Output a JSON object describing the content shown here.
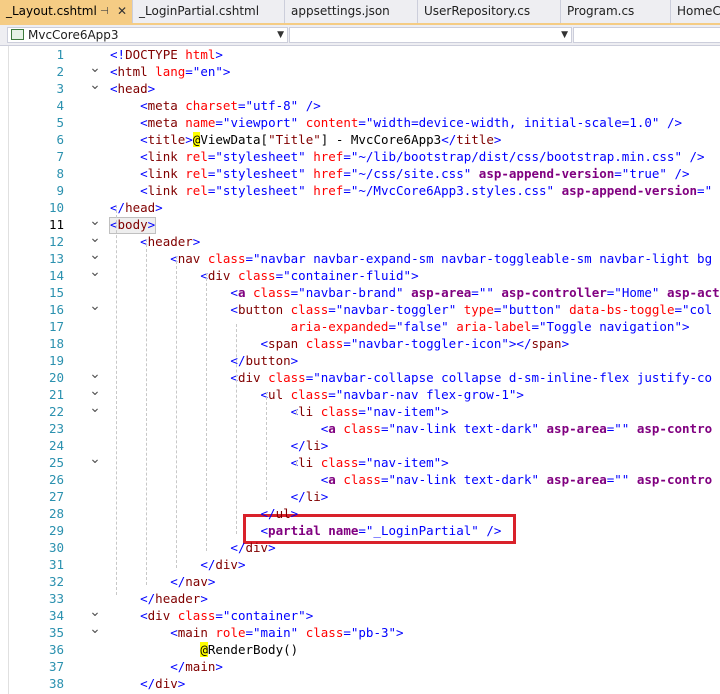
{
  "tabs": [
    {
      "label": "_Layout.cshtml",
      "active": true
    },
    {
      "label": "_LoginPartial.cshtml",
      "active": false
    },
    {
      "label": "appsettings.json",
      "active": false
    },
    {
      "label": "UserRepository.cs",
      "active": false
    },
    {
      "label": "Program.cs",
      "active": false
    },
    {
      "label": "HomeCo",
      "active": false
    }
  ],
  "tab_icons": {
    "pin": "pin-icon",
    "close": "close-icon"
  },
  "nav": {
    "project": "MvcCore6App3",
    "scope": ""
  },
  "colors": {
    "accent": "#f5cc84",
    "highlight_box": "#d9212a"
  },
  "editor": {
    "current_line": 11,
    "lines": [
      {
        "n": "1",
        "fold": "",
        "tokens": [
          [
            "<!",
            "delim"
          ],
          [
            "DOCTYPE ",
            "tag"
          ],
          [
            "html",
            "attr"
          ],
          [
            ">",
            "delim"
          ]
        ]
      },
      {
        "n": "2",
        "fold": "v",
        "tokens": [
          [
            "<",
            "delim"
          ],
          [
            "html ",
            "tag"
          ],
          [
            "lang",
            "attr"
          ],
          [
            "=\"en\"",
            "val"
          ],
          [
            ">",
            "delim"
          ]
        ]
      },
      {
        "n": "3",
        "fold": "v",
        "tokens": [
          [
            "<",
            "delim"
          ],
          [
            "head",
            "tag"
          ],
          [
            ">",
            "delim"
          ]
        ]
      },
      {
        "n": "4",
        "fold": "",
        "tokens": [
          [
            "    ",
            "text"
          ],
          [
            "<",
            "delim"
          ],
          [
            "meta ",
            "tag"
          ],
          [
            "charset",
            "attr"
          ],
          [
            "=\"utf-8\" ",
            "val"
          ],
          [
            "/>",
            "delim"
          ]
        ]
      },
      {
        "n": "5",
        "fold": "",
        "tokens": [
          [
            "    ",
            "text"
          ],
          [
            "<",
            "delim"
          ],
          [
            "meta ",
            "tag"
          ],
          [
            "name",
            "attr"
          ],
          [
            "=\"viewport\" ",
            "val"
          ],
          [
            "content",
            "attr"
          ],
          [
            "=\"width=device-width, initial-scale=1.0\" ",
            "val"
          ],
          [
            "/>",
            "delim"
          ]
        ]
      },
      {
        "n": "6",
        "fold": "",
        "tokens": [
          [
            "    ",
            "text"
          ],
          [
            "<",
            "delim"
          ],
          [
            "title",
            "tag"
          ],
          [
            ">",
            "delim"
          ],
          [
            "@",
            "razor"
          ],
          [
            "ViewData[",
            "text"
          ],
          [
            "\"Title\"",
            "tag"
          ],
          [
            "] - MvcCore6App3",
            "text"
          ],
          [
            "</",
            "delim"
          ],
          [
            "title",
            "tag"
          ],
          [
            ">",
            "delim"
          ]
        ]
      },
      {
        "n": "7",
        "fold": "",
        "tokens": [
          [
            "    ",
            "text"
          ],
          [
            "<",
            "delim"
          ],
          [
            "link ",
            "tag"
          ],
          [
            "rel",
            "attr"
          ],
          [
            "=\"stylesheet\" ",
            "val"
          ],
          [
            "href",
            "attr"
          ],
          [
            "=\"~/lib/bootstrap/dist/css/bootstrap.min.css\" ",
            "val"
          ],
          [
            "/>",
            "delim"
          ]
        ]
      },
      {
        "n": "8",
        "fold": "",
        "tokens": [
          [
            "    ",
            "text"
          ],
          [
            "<",
            "delim"
          ],
          [
            "link ",
            "tag"
          ],
          [
            "rel",
            "attr"
          ],
          [
            "=\"stylesheet\" ",
            "val"
          ],
          [
            "href",
            "attr"
          ],
          [
            "=\"~/css/site.css\" ",
            "val"
          ],
          [
            "asp-append-version",
            "tagh"
          ],
          [
            "=\"true\" ",
            "val"
          ],
          [
            "/>",
            "delim"
          ]
        ]
      },
      {
        "n": "9",
        "fold": "",
        "tokens": [
          [
            "    ",
            "text"
          ],
          [
            "<",
            "delim"
          ],
          [
            "link ",
            "tag"
          ],
          [
            "rel",
            "attr"
          ],
          [
            "=\"stylesheet\" ",
            "val"
          ],
          [
            "href",
            "attr"
          ],
          [
            "=\"~/MvcCore6App3.styles.css\" ",
            "val"
          ],
          [
            "asp-append-version",
            "tagh"
          ],
          [
            "=\"",
            "val"
          ]
        ]
      },
      {
        "n": "10",
        "fold": "",
        "tokens": [
          [
            "</",
            "delim"
          ],
          [
            "head",
            "tag"
          ],
          [
            ">",
            "delim"
          ]
        ]
      },
      {
        "n": "11",
        "fold": "v",
        "tokens": [
          [
            "<",
            "delim"
          ],
          [
            "body",
            "tag"
          ],
          [
            ">",
            "delim"
          ]
        ]
      },
      {
        "n": "12",
        "fold": "v",
        "tokens": [
          [
            "    ",
            "text"
          ],
          [
            "<",
            "delim"
          ],
          [
            "header",
            "tag"
          ],
          [
            ">",
            "delim"
          ]
        ]
      },
      {
        "n": "13",
        "fold": "v",
        "tokens": [
          [
            "        ",
            "text"
          ],
          [
            "<",
            "delim"
          ],
          [
            "nav ",
            "tag"
          ],
          [
            "class",
            "attr"
          ],
          [
            "=\"navbar navbar-expand-sm navbar-toggleable-sm navbar-light bg",
            "val"
          ]
        ]
      },
      {
        "n": "14",
        "fold": "v",
        "tokens": [
          [
            "            ",
            "text"
          ],
          [
            "<",
            "delim"
          ],
          [
            "div ",
            "tag"
          ],
          [
            "class",
            "attr"
          ],
          [
            "=\"container-fluid\"",
            "val"
          ],
          [
            ">",
            "delim"
          ]
        ]
      },
      {
        "n": "15",
        "fold": "",
        "tokens": [
          [
            "                ",
            "text"
          ],
          [
            "<",
            "delim"
          ],
          [
            "a ",
            "tagh"
          ],
          [
            "class",
            "attr"
          ],
          [
            "=\"navbar-brand\" ",
            "val"
          ],
          [
            "asp-area",
            "tagh"
          ],
          [
            "=\"\" ",
            "val"
          ],
          [
            "asp-controller",
            "tagh"
          ],
          [
            "=\"Home\" ",
            "val"
          ],
          [
            "asp-act",
            "tagh"
          ]
        ]
      },
      {
        "n": "16",
        "fold": "v",
        "tokens": [
          [
            "                ",
            "text"
          ],
          [
            "<",
            "delim"
          ],
          [
            "button ",
            "tag"
          ],
          [
            "class",
            "attr"
          ],
          [
            "=\"navbar-toggler\" ",
            "val"
          ],
          [
            "type",
            "attr"
          ],
          [
            "=\"button\" ",
            "val"
          ],
          [
            "data-bs-toggle",
            "attr"
          ],
          [
            "=\"col",
            "val"
          ]
        ]
      },
      {
        "n": "17",
        "fold": "",
        "tokens": [
          [
            "                        ",
            "text"
          ],
          [
            "aria-expanded",
            "attr"
          ],
          [
            "=\"false\" ",
            "val"
          ],
          [
            "aria-label",
            "attr"
          ],
          [
            "=\"Toggle navigation\"",
            "val"
          ],
          [
            ">",
            "delim"
          ]
        ]
      },
      {
        "n": "18",
        "fold": "",
        "tokens": [
          [
            "                    ",
            "text"
          ],
          [
            "<",
            "delim"
          ],
          [
            "span ",
            "tag"
          ],
          [
            "class",
            "attr"
          ],
          [
            "=\"navbar-toggler-icon\"",
            "val"
          ],
          [
            "></",
            "delim"
          ],
          [
            "span",
            "tag"
          ],
          [
            ">",
            "delim"
          ]
        ]
      },
      {
        "n": "19",
        "fold": "",
        "tokens": [
          [
            "                ",
            "text"
          ],
          [
            "</",
            "delim"
          ],
          [
            "button",
            "tag"
          ],
          [
            ">",
            "delim"
          ]
        ]
      },
      {
        "n": "20",
        "fold": "v",
        "tokens": [
          [
            "                ",
            "text"
          ],
          [
            "<",
            "delim"
          ],
          [
            "div ",
            "tag"
          ],
          [
            "class",
            "attr"
          ],
          [
            "=\"navbar-collapse collapse d-sm-inline-flex justify-co",
            "val"
          ]
        ]
      },
      {
        "n": "21",
        "fold": "v",
        "tokens": [
          [
            "                    ",
            "text"
          ],
          [
            "<",
            "delim"
          ],
          [
            "ul ",
            "tag"
          ],
          [
            "class",
            "attr"
          ],
          [
            "=\"navbar-nav flex-grow-1\"",
            "val"
          ],
          [
            ">",
            "delim"
          ]
        ]
      },
      {
        "n": "22",
        "fold": "v",
        "tokens": [
          [
            "                        ",
            "text"
          ],
          [
            "<",
            "delim"
          ],
          [
            "li ",
            "tag"
          ],
          [
            "class",
            "attr"
          ],
          [
            "=\"nav-item\"",
            "val"
          ],
          [
            ">",
            "delim"
          ]
        ]
      },
      {
        "n": "23",
        "fold": "",
        "tokens": [
          [
            "                            ",
            "text"
          ],
          [
            "<",
            "delim"
          ],
          [
            "a ",
            "tagh"
          ],
          [
            "class",
            "attr"
          ],
          [
            "=\"nav-link text-dark\" ",
            "val"
          ],
          [
            "asp-area",
            "tagh"
          ],
          [
            "=\"\" ",
            "val"
          ],
          [
            "asp-contro",
            "tagh"
          ]
        ]
      },
      {
        "n": "24",
        "fold": "",
        "tokens": [
          [
            "                        ",
            "text"
          ],
          [
            "</",
            "delim"
          ],
          [
            "li",
            "tag"
          ],
          [
            ">",
            "delim"
          ]
        ]
      },
      {
        "n": "25",
        "fold": "v",
        "tokens": [
          [
            "                        ",
            "text"
          ],
          [
            "<",
            "delim"
          ],
          [
            "li ",
            "tag"
          ],
          [
            "class",
            "attr"
          ],
          [
            "=\"nav-item\"",
            "val"
          ],
          [
            ">",
            "delim"
          ]
        ]
      },
      {
        "n": "26",
        "fold": "",
        "tokens": [
          [
            "                            ",
            "text"
          ],
          [
            "<",
            "delim"
          ],
          [
            "a ",
            "tagh"
          ],
          [
            "class",
            "attr"
          ],
          [
            "=\"nav-link text-dark\" ",
            "val"
          ],
          [
            "asp-area",
            "tagh"
          ],
          [
            "=\"\" ",
            "val"
          ],
          [
            "asp-contro",
            "tagh"
          ]
        ]
      },
      {
        "n": "27",
        "fold": "",
        "tokens": [
          [
            "                        ",
            "text"
          ],
          [
            "</",
            "delim"
          ],
          [
            "li",
            "tag"
          ],
          [
            ">",
            "delim"
          ]
        ]
      },
      {
        "n": "28",
        "fold": "",
        "tokens": [
          [
            "                    ",
            "text"
          ],
          [
            "</",
            "delim"
          ],
          [
            "ul",
            "tag"
          ],
          [
            ">",
            "delim"
          ]
        ]
      },
      {
        "n": "29",
        "fold": "",
        "tokens": [
          [
            "                    ",
            "text"
          ],
          [
            "<",
            "delim"
          ],
          [
            "partial ",
            "tagh"
          ],
          [
            "name",
            "attrh"
          ],
          [
            "=\"_LoginPartial\" ",
            "val"
          ],
          [
            "/>",
            "delim"
          ]
        ]
      },
      {
        "n": "30",
        "fold": "",
        "tokens": [
          [
            "                ",
            "text"
          ],
          [
            "</",
            "delim"
          ],
          [
            "div",
            "tag"
          ],
          [
            ">",
            "delim"
          ]
        ]
      },
      {
        "n": "31",
        "fold": "",
        "tokens": [
          [
            "            ",
            "text"
          ],
          [
            "</",
            "delim"
          ],
          [
            "div",
            "tag"
          ],
          [
            ">",
            "delim"
          ]
        ]
      },
      {
        "n": "32",
        "fold": "",
        "tokens": [
          [
            "        ",
            "text"
          ],
          [
            "</",
            "delim"
          ],
          [
            "nav",
            "tag"
          ],
          [
            ">",
            "delim"
          ]
        ]
      },
      {
        "n": "33",
        "fold": "",
        "tokens": [
          [
            "    ",
            "text"
          ],
          [
            "</",
            "delim"
          ],
          [
            "header",
            "tag"
          ],
          [
            ">",
            "delim"
          ]
        ]
      },
      {
        "n": "34",
        "fold": "v",
        "tokens": [
          [
            "    ",
            "text"
          ],
          [
            "<",
            "delim"
          ],
          [
            "div ",
            "tag"
          ],
          [
            "class",
            "attr"
          ],
          [
            "=\"container\"",
            "val"
          ],
          [
            ">",
            "delim"
          ]
        ]
      },
      {
        "n": "35",
        "fold": "v",
        "tokens": [
          [
            "        ",
            "text"
          ],
          [
            "<",
            "delim"
          ],
          [
            "main ",
            "tag"
          ],
          [
            "role",
            "attr"
          ],
          [
            "=\"main\" ",
            "val"
          ],
          [
            "class",
            "attr"
          ],
          [
            "=\"pb-3\"",
            "val"
          ],
          [
            ">",
            "delim"
          ]
        ]
      },
      {
        "n": "36",
        "fold": "",
        "tokens": [
          [
            "            ",
            "text"
          ],
          [
            "@",
            "razor"
          ],
          [
            "RenderBody",
            "text"
          ],
          [
            "()",
            "text"
          ]
        ]
      },
      {
        "n": "37",
        "fold": "",
        "tokens": [
          [
            "        ",
            "text"
          ],
          [
            "</",
            "delim"
          ],
          [
            "main",
            "tag"
          ],
          [
            ">",
            "delim"
          ]
        ]
      },
      {
        "n": "38",
        "fold": "",
        "tokens": [
          [
            "    ",
            "text"
          ],
          [
            "</",
            "delim"
          ],
          [
            "div",
            "tag"
          ],
          [
            ">",
            "delim"
          ]
        ]
      }
    ]
  }
}
